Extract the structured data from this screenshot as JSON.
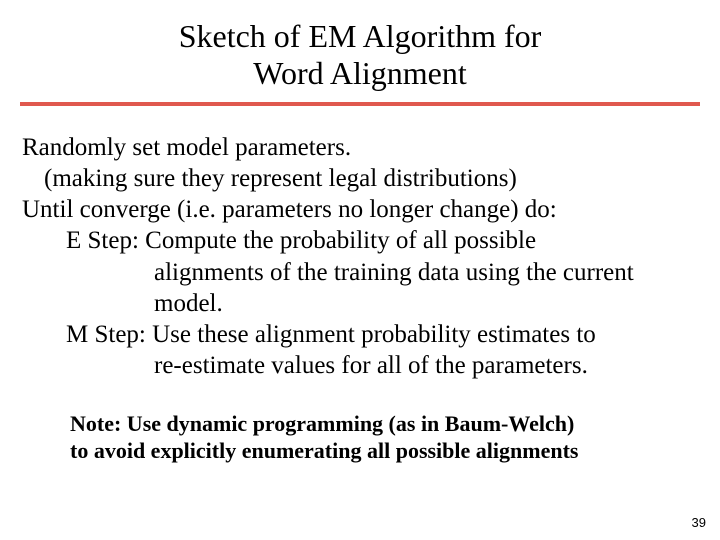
{
  "title": {
    "line1": "Sketch of EM Algorithm for",
    "line2": "Word Alignment"
  },
  "body": {
    "l1": "Randomly set model parameters.",
    "l2": "(making sure they represent legal distributions)",
    "l3": "Until converge (i.e. parameters no longer change) do:",
    "l4": "E Step: Compute the probability of all possible",
    "l5": "alignments of the training data using the current",
    "l6": "model.",
    "l7": "M Step: Use these alignment probability estimates to",
    "l8": "re-estimate values for all of the parameters."
  },
  "note": {
    "l1": "Note: Use dynamic programming (as in Baum-Welch)",
    "l2": "to avoid explicitly enumerating all possible alignments"
  },
  "page_number": "39",
  "colors": {
    "rule": "#e0584e"
  }
}
